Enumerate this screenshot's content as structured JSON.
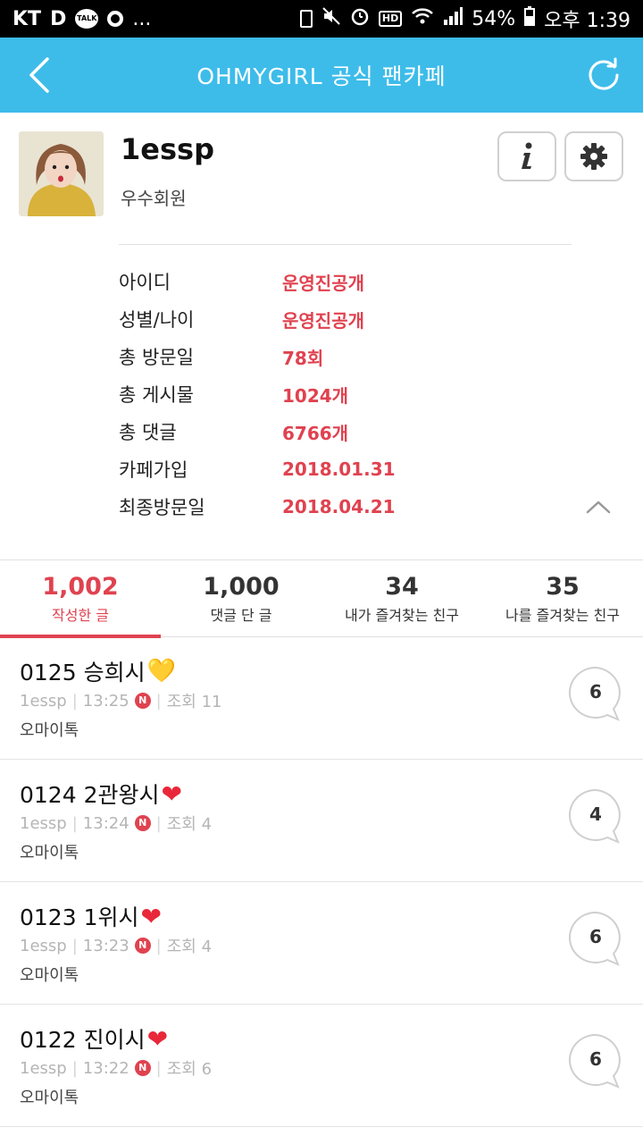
{
  "status_bar": {
    "carrier": "KT",
    "more": "...",
    "battery": "54%",
    "time": "오후 1:39",
    "hd": "HD"
  },
  "app_bar": {
    "title": "OHMYGIRL 공식 팬카페"
  },
  "profile": {
    "nickname": "1essp",
    "rank": "우수회원",
    "details": [
      {
        "label": "아이디",
        "value": "운영진공개"
      },
      {
        "label": "성별/나이",
        "value": "운영진공개"
      },
      {
        "label": "총 방문일",
        "value": "78회"
      },
      {
        "label": "총 게시물",
        "value": "1024개"
      },
      {
        "label": "총 댓글",
        "value": "6766개"
      },
      {
        "label": "카페가입",
        "value": "2018.01.31"
      },
      {
        "label": "최종방문일",
        "value": "2018.04.21"
      }
    ]
  },
  "tabs": [
    {
      "count": "1,002",
      "label": "작성한 글",
      "active": true
    },
    {
      "count": "1,000",
      "label": "댓글 단 글",
      "active": false
    },
    {
      "count": "34",
      "label": "내가 즐겨찾는 친구",
      "active": false
    },
    {
      "count": "35",
      "label": "나를 즐겨찾는 친구",
      "active": false
    }
  ],
  "posts": [
    {
      "title": "0125 승희시",
      "emoji": "💛",
      "author": "1essp",
      "time": "13:25",
      "new": "N",
      "views": "조회 11",
      "board": "오마이톡",
      "comments": "6"
    },
    {
      "title": "0124 2관왕시",
      "emoji": "❤",
      "author": "1essp",
      "time": "13:24",
      "new": "N",
      "views": "조회 4",
      "board": "오마이톡",
      "comments": "4"
    },
    {
      "title": "0123 1위시",
      "emoji": "❤",
      "author": "1essp",
      "time": "13:23",
      "new": "N",
      "views": "조회 4",
      "board": "오마이톡",
      "comments": "6"
    },
    {
      "title": "0122 진이시",
      "emoji": "❤",
      "author": "1essp",
      "time": "13:22",
      "new": "N",
      "views": "조회 6",
      "board": "오마이톡",
      "comments": "6"
    }
  ],
  "colors": {
    "app_bar": "#3dbcea",
    "accent_red": "#e0424f"
  }
}
